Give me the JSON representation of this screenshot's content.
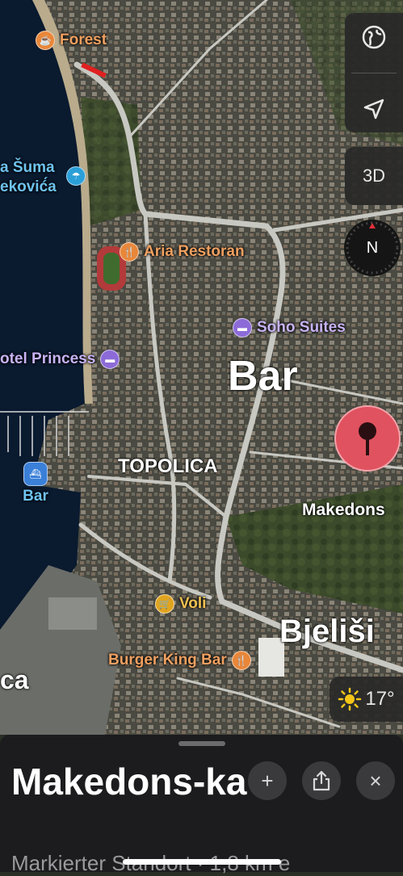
{
  "map": {
    "labels": {
      "forest": "Forest",
      "suma_line1": "a Šuma",
      "suma_line2": "eković́a",
      "aria": "Aria Restoran",
      "soho": "Soho Suites",
      "princess": "otel Princess",
      "bar_city": "Bar",
      "topolica": "TOPOLICA",
      "bar_port": "Bar",
      "makedonska_map": "Makedons",
      "voli": "Voli",
      "bjelisi": "Bjeliši",
      "burger_king": "Burger King Bar",
      "ca": "ca"
    },
    "controls": {
      "three_d": "3D",
      "compass": "N",
      "temperature": "17°"
    },
    "colors": {
      "sea": "#0a1a2f",
      "food_pin": "#e8873a",
      "hotel_pin": "#8c6bd8",
      "port_pin": "#3a7fd8",
      "beach_pin": "#2a9fd8",
      "shop_pin": "#e0a41f",
      "marker": "#e0525f"
    }
  },
  "sheet": {
    "title": "Makedons-ka",
    "subtitle": "Markierter Standort · 1,8 km e",
    "add_icon": "+",
    "share_icon": "share",
    "close_icon": "×"
  }
}
